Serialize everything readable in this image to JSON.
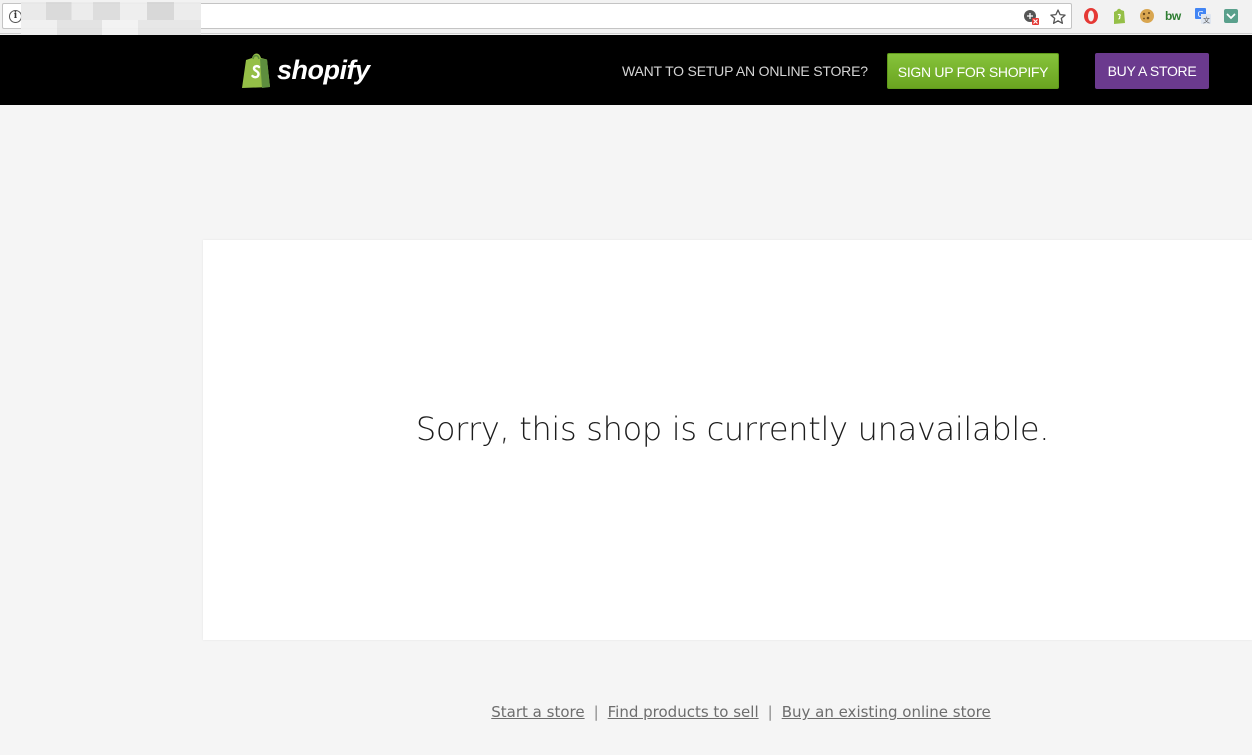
{
  "browser": {
    "extensions": [
      "opera-icon",
      "shopify-extension-icon",
      "cookie-icon",
      "bw-extension-icon",
      "translate-icon",
      "pocket-icon"
    ],
    "extension_bw_label": "bw"
  },
  "header": {
    "logo_text": "shopify",
    "setup_prompt": "WANT TO SETUP AN ONLINE STORE?",
    "signup_label": "SIGN UP FOR SHOPIFY",
    "buy_label": "BUY A STORE",
    "colors": {
      "bar": "#000000",
      "signup": "#76b22c",
      "buy": "#6b3a8e",
      "logo_green": "#95bf47"
    }
  },
  "main": {
    "message": "Sorry, this shop is currently unavailable."
  },
  "footer": {
    "links": [
      "Start a store",
      "Find products to sell",
      "Buy an existing online store"
    ],
    "separator": "|"
  }
}
